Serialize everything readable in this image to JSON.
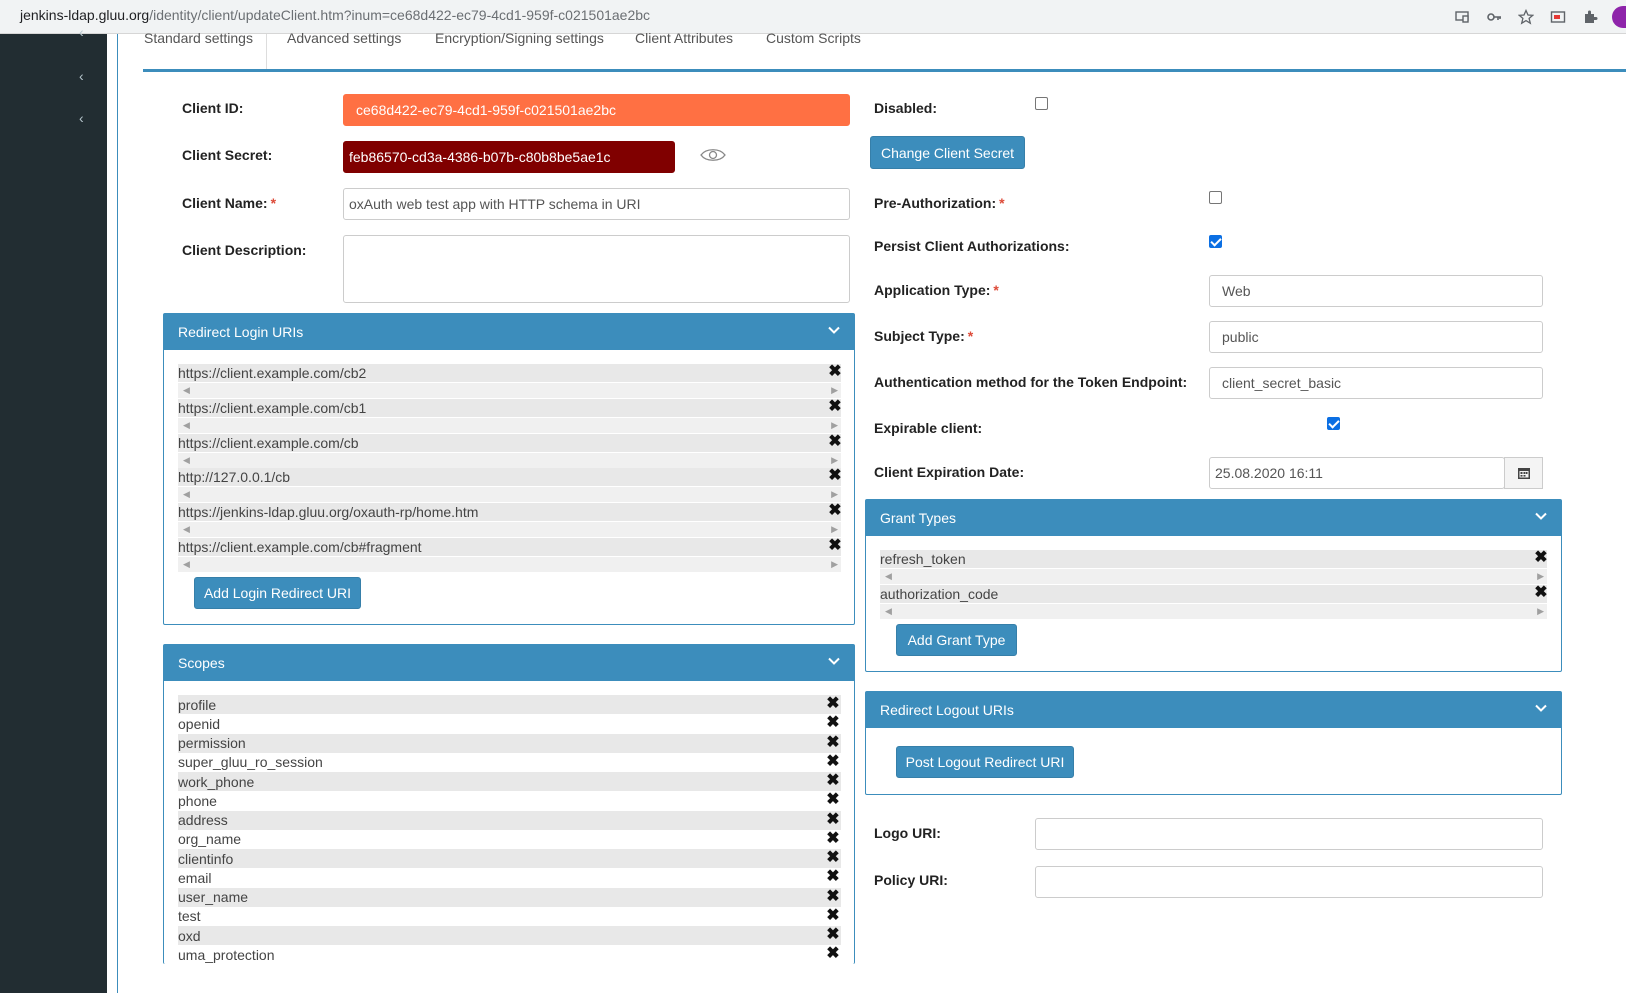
{
  "browser": {
    "url_host": "jenkins-ldap.gluu.org",
    "url_path": "/identity/client/updateClient.htm?inum=ce68d422-ec79-4cd1-959f-c021501ae2bc",
    "icons": [
      "cast-icon",
      "key-icon",
      "star-icon",
      "screen-capture-icon",
      "extensions-icon"
    ]
  },
  "tabs": [
    "Standard settings",
    "Advanced settings",
    "Encryption/Signing settings",
    "Client Attributes",
    "Custom Scripts"
  ],
  "left": {
    "client_id_label": "Client ID:",
    "client_id_value": "ce68d422-ec79-4cd1-959f-c021501ae2bc",
    "client_secret_label": "Client Secret:",
    "client_secret_value": "feb86570-cd3a-4386-b07b-c80b8be5ae1c",
    "client_name_label": "Client Name:",
    "client_name_value": "oxAuth web test app with HTTP schema in URI",
    "client_description_label": "Client Description:",
    "client_description_value": ""
  },
  "redirect_login": {
    "title": "Redirect Login URIs",
    "uris": [
      "https://client.example.com/cb2",
      "https://client.example.com/cb1",
      "https://client.example.com/cb",
      "http://127.0.0.1/cb",
      "https://jenkins-ldap.gluu.org/oxauth-rp/home.htm",
      "https://client.example.com/cb#fragment"
    ],
    "add_button": "Add Login Redirect URI"
  },
  "scopes": {
    "title": "Scopes",
    "items": [
      "profile",
      "openid",
      "permission",
      "super_gluu_ro_session",
      "work_phone",
      "phone",
      "address",
      "org_name",
      "clientinfo",
      "email",
      "user_name",
      "test",
      "oxd",
      "uma_protection"
    ]
  },
  "right": {
    "disabled_label": "Disabled:",
    "disabled_checked": false,
    "change_secret_button": "Change Client Secret",
    "pre_auth_label": "Pre-Authorization:",
    "pre_auth_checked": false,
    "persist_label": "Persist Client Authorizations:",
    "persist_checked": true,
    "app_type_label": "Application Type:",
    "app_type_value": "Web",
    "subject_type_label": "Subject Type:",
    "subject_type_value": "public",
    "auth_method_label": "Authentication method for the Token Endpoint:",
    "auth_method_value": "client_secret_basic",
    "expirable_label": "Expirable client:",
    "expirable_checked": true,
    "expiration_label": "Client Expiration Date:",
    "expiration_value": "25.08.2020 16:11",
    "logo_label": "Logo URI:",
    "logo_value": "",
    "policy_label": "Policy URI:",
    "policy_value": ""
  },
  "grant_types": {
    "title": "Grant Types",
    "items": [
      "refresh_token",
      "authorization_code"
    ],
    "add_button": "Add Grant Type"
  },
  "redirect_logout": {
    "title": "Redirect Logout URIs",
    "add_button": "Post Logout Redirect URI"
  },
  "colors": {
    "client_id_bg": "#ff7043",
    "client_secret_bg": "#800000",
    "primary": "#3c8dbc",
    "sidebar": "#222d32"
  }
}
